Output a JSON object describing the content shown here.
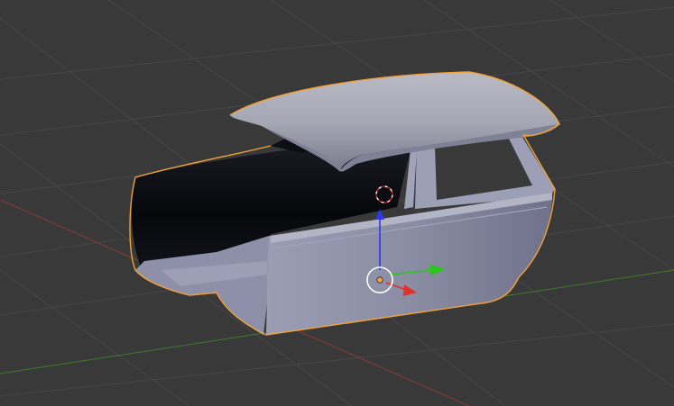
{
  "viewport": {
    "background": "#393939",
    "grid_color": "#474747",
    "x_axis_color": "#8a3a3a",
    "y_axis_color": "#3f7a2a"
  },
  "object": {
    "selected": true,
    "selection_outline_color": "#f3a23a",
    "body_color": "#8e91a8",
    "roof_color": "#a9abb8",
    "interior_color": "#0b0c12"
  },
  "manipulator": {
    "x_axis_color": "#e0302a",
    "y_axis_color": "#28c818",
    "z_axis_color": "#2a3aee",
    "ring_color": "#ffffff",
    "origin_color": "#f7a53c"
  },
  "icons": {
    "cursor": "3d-cursor-icon",
    "gizmo": "transform-gizmo-icon",
    "origin": "object-origin-icon"
  }
}
